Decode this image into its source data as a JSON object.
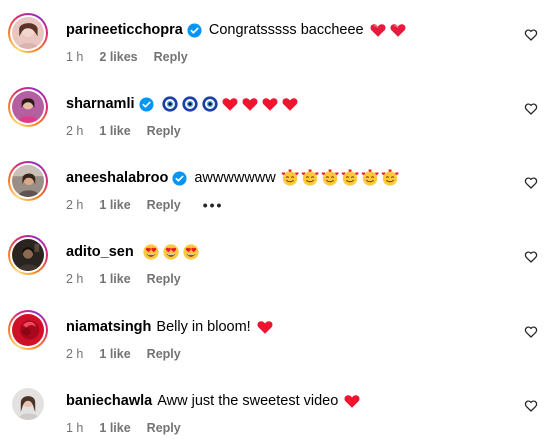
{
  "comments": [
    {
      "username": "parineeticchopra",
      "verified": true,
      "text": "Congratsssss baccheee",
      "emojis": [
        "heart-on-fire",
        "heart-on-fire"
      ],
      "time": "1 h",
      "likes": "2 likes",
      "reply_label": "Reply",
      "avatar_icon": "avatar-photo"
    },
    {
      "username": "sharnamli",
      "verified": true,
      "text": "",
      "emojis": [
        "nazar-amulet",
        "nazar-amulet",
        "nazar-amulet",
        "red-heart",
        "red-heart",
        "red-heart",
        "red-heart"
      ],
      "time": "2 h",
      "likes": "1 like",
      "reply_label": "Reply",
      "avatar_icon": "avatar-photo"
    },
    {
      "username": "aneeshalabroo",
      "verified": true,
      "text": "awwwwwww",
      "emojis": [
        "smiling-face-with-hearts",
        "smiling-face-with-hearts",
        "smiling-face-with-hearts",
        "smiling-face-with-hearts",
        "smiling-face-with-hearts",
        "smiling-face-with-hearts"
      ],
      "time": "2 h",
      "likes": "1 like",
      "reply_label": "Reply",
      "more_label": "•••",
      "avatar_icon": "avatar-photo"
    },
    {
      "username": "adito_sen",
      "verified": false,
      "text": "",
      "emojis": [
        "heart-eyes",
        "heart-eyes",
        "heart-eyes"
      ],
      "time": "2 h",
      "likes": "1 like",
      "reply_label": "Reply",
      "avatar_icon": "avatar-photo"
    },
    {
      "username": "niamatsingh",
      "verified": false,
      "text": "Belly in bloom!",
      "emojis": [
        "red-heart"
      ],
      "time": "2 h",
      "likes": "1 like",
      "reply_label": "Reply",
      "avatar_icon": "avatar-photo"
    },
    {
      "username": "baniechawla",
      "verified": false,
      "text": "Aww just the sweetest video",
      "emojis": [
        "red-heart"
      ],
      "time": "1 h",
      "likes": "1 like",
      "reply_label": "Reply",
      "avatar_icon": "avatar-photo"
    }
  ],
  "colors": {
    "verified_blue": "#0095f6",
    "meta_gray": "#737373",
    "heart_red": "#f0142f",
    "nazar_blue": "#1f3fa8"
  }
}
